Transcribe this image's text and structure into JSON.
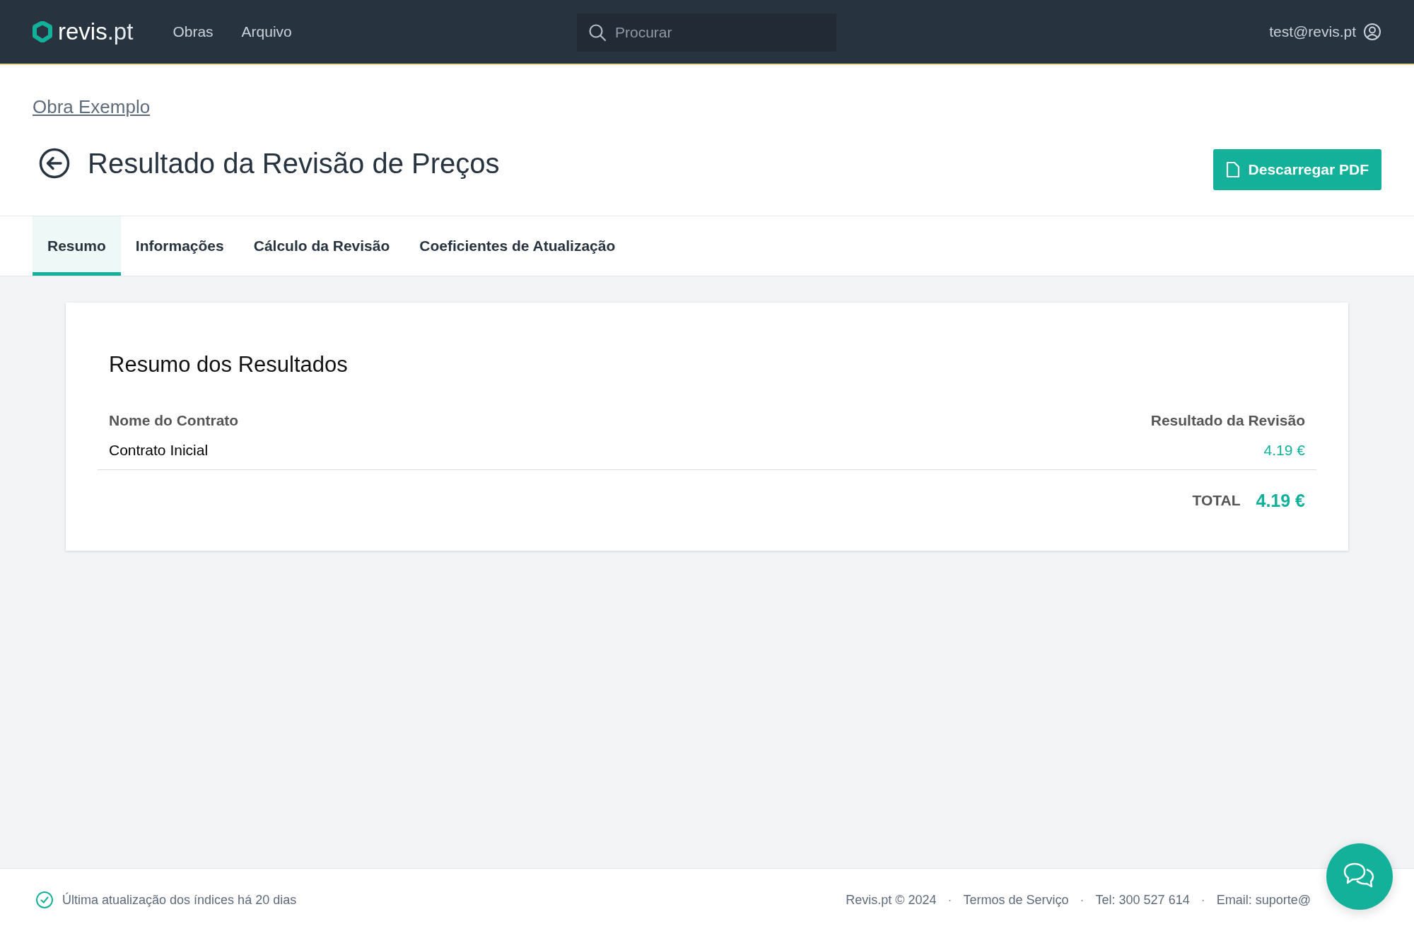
{
  "header": {
    "logo": "revis",
    "logo_suffix": ".pt",
    "nav": [
      {
        "label": "Obras"
      },
      {
        "label": "Arquivo"
      }
    ],
    "search": {
      "placeholder": "Procurar"
    },
    "user": "test@revis.pt"
  },
  "breadcrumb": "Obra Exemplo",
  "title": "Resultado da Revisão de Preços",
  "download_button": "Descarregar PDF",
  "tabs": [
    {
      "label": "Resumo",
      "selected": true
    },
    {
      "label": "Informações",
      "selected": false
    },
    {
      "label": "Cálculo da Revisão",
      "selected": false
    },
    {
      "label": "Coeficientes de Atualização",
      "selected": false
    }
  ],
  "summary": {
    "title": "Resumo dos Resultados",
    "columns": [
      "Nome do Contrato",
      "Resultado da Revisão"
    ],
    "rows": [
      {
        "name": "Contrato Inicial",
        "result": "4.19 €"
      }
    ],
    "total_label": "TOTAL",
    "total": "4.19 €"
  },
  "footer": {
    "status": "Última atualização dos índices há 20 dias",
    "links": [
      "Revis.pt © 2024",
      "Termos de Serviço",
      "Tel: 300 527 614",
      "Email: suporte@"
    ],
    "separator": "·"
  }
}
